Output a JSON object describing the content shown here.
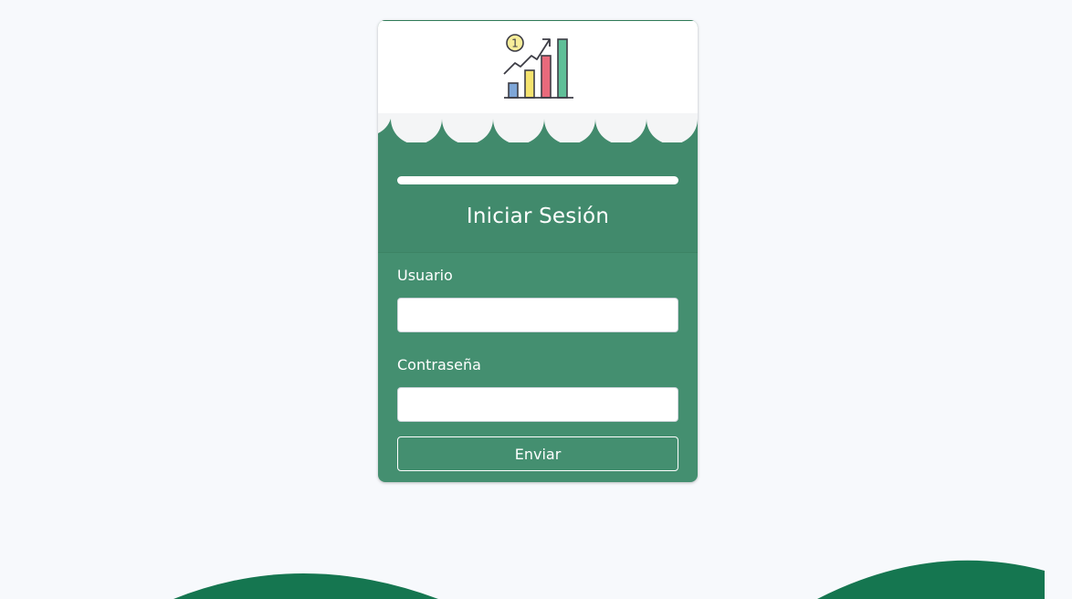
{
  "login": {
    "title": "Iniciar Sesión",
    "username_label": "Usuario",
    "username_value": "",
    "password_label": "Contraseña",
    "password_value": "",
    "submit_label": "Enviar"
  },
  "logo": {
    "icon": "growth-chart-icon",
    "badge_text": "1"
  },
  "colors": {
    "background": "#f7f9fc",
    "card_green": "#448f70",
    "header_green": "#418a6c",
    "wave_green": "#157650",
    "scallop_gray": "#f4f5f6"
  }
}
